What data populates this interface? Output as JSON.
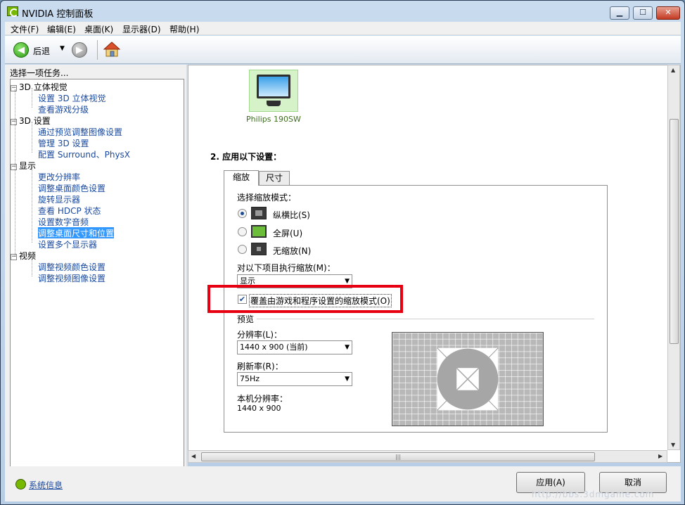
{
  "window": {
    "title": "NVIDIA 控制面板"
  },
  "menu": [
    "文件(F)",
    "编辑(E)",
    "桌面(K)",
    "显示器(D)",
    "帮助(H)"
  ],
  "toolbar": {
    "back_label": "后退"
  },
  "sidebar": {
    "header": "选择一项任务...",
    "categories": [
      {
        "label": "3D 立体视觉",
        "items": [
          "设置 3D 立体视觉",
          "查看游戏分级"
        ]
      },
      {
        "label": "3D 设置",
        "items": [
          "通过预览调整图像设置",
          "管理 3D 设置",
          "配置 Surround、PhysX"
        ]
      },
      {
        "label": "显示",
        "items": [
          "更改分辨率",
          "调整桌面颜色设置",
          "旋转显示器",
          "查看 HDCP 状态",
          "设置数字音频",
          "调整桌面尺寸和位置",
          "设置多个显示器"
        ]
      },
      {
        "label": "视频",
        "items": [
          "调整视频颜色设置",
          "调整视频图像设置"
        ]
      }
    ],
    "selected": "调整桌面尺寸和位置"
  },
  "content": {
    "display_name": "Philips 190SW",
    "section_title": "2.  应用以下设置：",
    "tabs": [
      "缩放",
      "尺寸"
    ],
    "active_tab": "缩放",
    "scaling_mode_label": "选择缩放模式：",
    "scaling_modes": [
      "纵横比(S)",
      "全屏(U)",
      "无缩放(N)"
    ],
    "selected_mode": "纵横比(S)",
    "perform_scaling_label": "对以下项目执行缩放(M)：",
    "perform_scaling_value": "显示",
    "override_label": "覆盖由游戏和程序设置的缩放模式(O)",
    "override_checked": true,
    "preview_label": "预览",
    "resolution_label": "分辨率(L)：",
    "resolution_value": "1440 x 900 (当前)",
    "refresh_label": "刷新率(R)：",
    "refresh_value": "75Hz",
    "native_label": "本机分辨率：",
    "native_value": "1440 x 900"
  },
  "footer": {
    "system_info": "系统信息",
    "apply": "应用(A)",
    "cancel": "取消"
  },
  "watermark": "http://bbs.3dmgame.com"
}
